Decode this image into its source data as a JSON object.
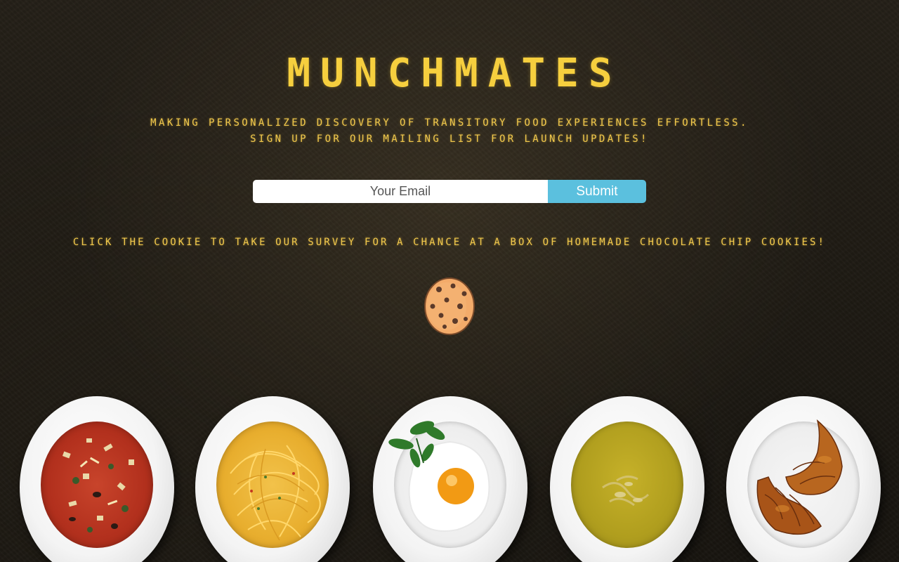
{
  "header": {
    "title": "MUNCHMATES",
    "tagline_line1": "MAKING PERSONALIZED DISCOVERY OF TRANSITORY FOOD EXPERIENCES EFFORTLESS.",
    "tagline_line2": "SIGN UP FOR OUR MAILING LIST FOR LAUNCH UPDATES!"
  },
  "signup": {
    "email_placeholder": "Your Email",
    "submit_label": "Submit"
  },
  "survey": {
    "text": "CLICK THE COOKIE TO TAKE OUR SURVEY FOR A CHANCE AT A BOX OF HOMEMADE CHOCOLATE CHIP COOKIES!",
    "cookie_icon": "cookie-icon"
  },
  "plates": [
    {
      "icon": "soup-plate-icon"
    },
    {
      "icon": "spaghetti-plate-icon"
    },
    {
      "icon": "fried-egg-plate-icon"
    },
    {
      "icon": "pea-soup-plate-icon"
    },
    {
      "icon": "croissant-plate-icon"
    }
  ],
  "colors": {
    "accent": "#f6cf3e",
    "button": "#5bc0de",
    "background": "#1e1a13"
  }
}
